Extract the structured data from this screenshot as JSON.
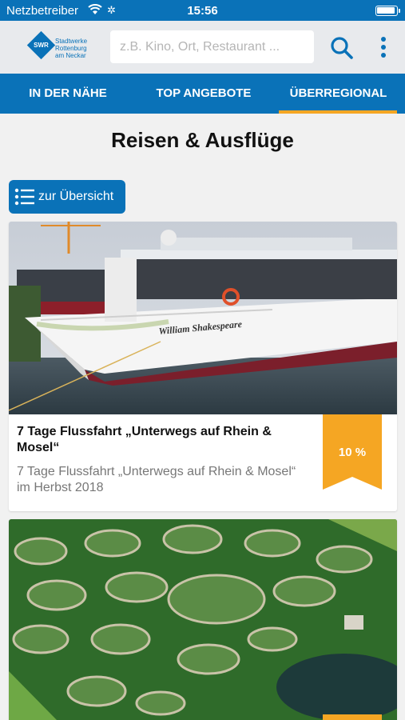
{
  "status_bar": {
    "carrier": "Netzbetreiber",
    "time": "15:56"
  },
  "header": {
    "logo_badge": "SWR",
    "logo_text": "Stadtwerke Rottenburg am Neckar",
    "search_placeholder": "z.B. Kino, Ort, Restaurant ..."
  },
  "tabs": [
    {
      "label": "IN DER NÄHE",
      "active": false
    },
    {
      "label": "TOP ANGEBOTE",
      "active": false
    },
    {
      "label": "ÜBERREGIONAL",
      "active": true
    }
  ],
  "page": {
    "title": "Reisen & Ausflüge",
    "overview_label": "zur Übersicht"
  },
  "cards": [
    {
      "title": "7 Tage Flussfahrt „Unterwegs auf Rhein & Mosel“",
      "description": "7 Tage Flussfahrt „Unterwegs auf Rhein & Mosel“ im Herbst 2018",
      "discount": "10 %",
      "image_ship_name": "William Shakespeare"
    },
    {
      "title": "",
      "description": "",
      "discount": ""
    }
  ],
  "colors": {
    "primary": "#0a72b8",
    "accent": "#f5a623"
  }
}
